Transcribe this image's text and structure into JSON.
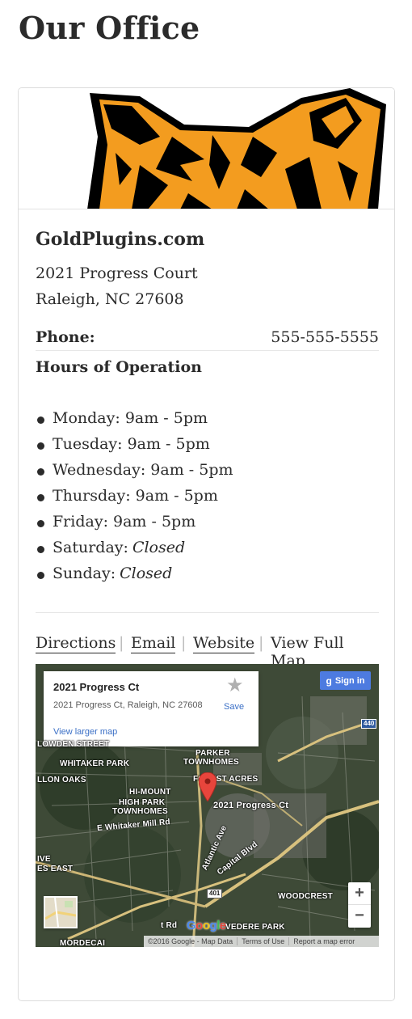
{
  "page": {
    "title": "Our Office"
  },
  "business": {
    "name": "GoldPlugins.com",
    "address_line1": "2021 Progress Court",
    "address_line2": "Raleigh, NC 27608",
    "phone_label": "Phone:",
    "phone_value": "555-555-5555"
  },
  "hours": {
    "title": "Hours of Operation",
    "days": [
      {
        "day": "Monday:",
        "value": "9am - 5pm",
        "closed": false
      },
      {
        "day": "Tuesday:",
        "value": "9am - 5pm",
        "closed": false
      },
      {
        "day": "Wednesday:",
        "value": "9am - 5pm",
        "closed": false
      },
      {
        "day": "Thursday:",
        "value": "9am - 5pm",
        "closed": false
      },
      {
        "day": "Friday:",
        "value": "9am - 5pm",
        "closed": false
      },
      {
        "day": "Saturday:",
        "value": "Closed",
        "closed": true
      },
      {
        "day": "Sunday:",
        "value": "Closed",
        "closed": true
      }
    ]
  },
  "links": {
    "directions": "Directions",
    "email": "Email",
    "website": "Website",
    "full_map": "View Full Map",
    "separator": "|"
  },
  "map": {
    "info_title": "2021 Progress Ct",
    "info_address": "2021 Progress Ct, Raleigh, NC 27608",
    "view_larger": "View larger map",
    "save_label": "Save",
    "sign_in": "Sign in",
    "pin_label": "2021 Progress Ct",
    "labels": {
      "lowden": "LOWDEN STREET",
      "whitaker_park": "WHITAKER PARK",
      "parker": "PARKER",
      "townhomes": "TOWNHOMES",
      "forest_acres": "FOREST ACRES",
      "llon_oaks": "LLON OAKS",
      "hi_mount": "HI-MOUNT",
      "high_park": "HIGH PARK",
      "townhomes2": "TOWNHOMES",
      "whitaker_mill": "E Whitaker Mill Rd",
      "atlantic": "Atlantic Ave",
      "capital": "Capital Blvd",
      "ive": "IVE",
      "es_east": "ES EAST",
      "woodcrest": "WOODCREST",
      "belvedere": "VEDERE PARK",
      "ahead_rd": "t Rd",
      "mordecai": "MORDECAI"
    },
    "shields": {
      "i440": "440",
      "us401": "401"
    },
    "google_logo": "Google",
    "footer": [
      "©2016 Google - Map Data",
      "Terms of Use",
      "Report a map error"
    ],
    "zoom_in": "+",
    "zoom_out": "−"
  }
}
